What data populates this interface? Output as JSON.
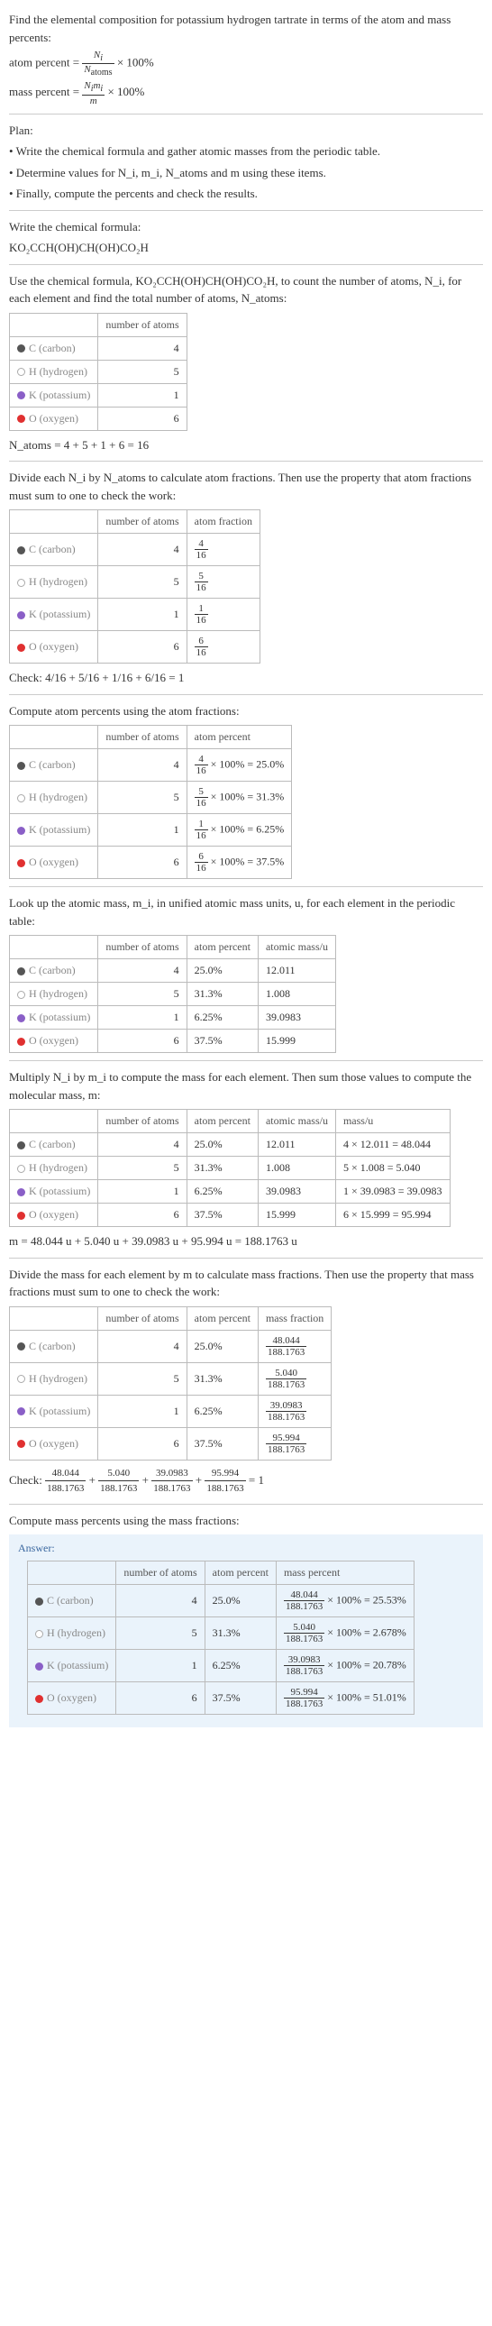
{
  "intro": {
    "line1": "Find the elemental composition for potassium hydrogen tartrate in terms of the atom and mass percents:",
    "atom_percent_label": "atom percent =",
    "atom_percent_num": "N_i",
    "atom_percent_den": "N_atoms",
    "times100": "× 100%",
    "mass_percent_label": "mass percent =",
    "mass_percent_num": "N_i m_i",
    "mass_percent_den": "m"
  },
  "plan": {
    "title": "Plan:",
    "b1": "• Write the chemical formula and gather atomic masses from the periodic table.",
    "b2": "• Determine values for N_i, m_i, N_atoms and m using these items.",
    "b3": "• Finally, compute the percents and check the results."
  },
  "formula": {
    "title": "Write the chemical formula:",
    "text": "KO₂CCH(OH)CH(OH)CO₂H"
  },
  "count": {
    "intro": "Use the chemical formula, KO₂CCH(OH)CH(OH)CO₂H, to count the number of atoms, N_i, for each element and find the total number of atoms, N_atoms:",
    "headers": {
      "col1": "",
      "col2": "number of atoms"
    },
    "rows": [
      {
        "element": "C (carbon)",
        "n": "4",
        "class": "c-carbon"
      },
      {
        "element": "H (hydrogen)",
        "n": "5",
        "class": "c-hydrogen"
      },
      {
        "element": "K (potassium)",
        "n": "1",
        "class": "c-potassium"
      },
      {
        "element": "O (oxygen)",
        "n": "6",
        "class": "c-oxygen"
      }
    ],
    "sum": "N_atoms = 4 + 5 + 1 + 6 = 16"
  },
  "atom_fractions": {
    "intro": "Divide each N_i by N_atoms to calculate atom fractions. Then use the property that atom fractions must sum to one to check the work:",
    "headers": {
      "col1": "",
      "col2": "number of atoms",
      "col3": "atom fraction"
    },
    "rows": [
      {
        "element": "C (carbon)",
        "n": "4",
        "fnum": "4",
        "fden": "16",
        "class": "c-carbon"
      },
      {
        "element": "H (hydrogen)",
        "n": "5",
        "fnum": "5",
        "fden": "16",
        "class": "c-hydrogen"
      },
      {
        "element": "K (potassium)",
        "n": "1",
        "fnum": "1",
        "fden": "16",
        "class": "c-potassium"
      },
      {
        "element": "O (oxygen)",
        "n": "6",
        "fnum": "6",
        "fden": "16",
        "class": "c-oxygen"
      }
    ],
    "check_label": "Check:",
    "check": "4/16 + 5/16 + 1/16 + 6/16 = 1"
  },
  "atom_percents": {
    "intro": "Compute atom percents using the atom fractions:",
    "headers": {
      "col1": "",
      "col2": "number of atoms",
      "col3": "atom percent"
    },
    "rows": [
      {
        "element": "C (carbon)",
        "n": "4",
        "fnum": "4",
        "fden": "16",
        "pct": "× 100% = 25.0%",
        "class": "c-carbon"
      },
      {
        "element": "H (hydrogen)",
        "n": "5",
        "fnum": "5",
        "fden": "16",
        "pct": "× 100% = 31.3%",
        "class": "c-hydrogen"
      },
      {
        "element": "K (potassium)",
        "n": "1",
        "fnum": "1",
        "fden": "16",
        "pct": "× 100% = 6.25%",
        "class": "c-potassium"
      },
      {
        "element": "O (oxygen)",
        "n": "6",
        "fnum": "6",
        "fden": "16",
        "pct": "× 100% = 37.5%",
        "class": "c-oxygen"
      }
    ]
  },
  "atomic_mass": {
    "intro": "Look up the atomic mass, m_i, in unified atomic mass units, u, for each element in the periodic table:",
    "headers": {
      "col1": "",
      "col2": "number of atoms",
      "col3": "atom percent",
      "col4": "atomic mass/u"
    },
    "rows": [
      {
        "element": "C (carbon)",
        "n": "4",
        "pct": "25.0%",
        "mass": "12.011",
        "class": "c-carbon"
      },
      {
        "element": "H (hydrogen)",
        "n": "5",
        "pct": "31.3%",
        "mass": "1.008",
        "class": "c-hydrogen"
      },
      {
        "element": "K (potassium)",
        "n": "1",
        "pct": "6.25%",
        "mass": "39.0983",
        "class": "c-potassium"
      },
      {
        "element": "O (oxygen)",
        "n": "6",
        "pct": "37.5%",
        "mass": "15.999",
        "class": "c-oxygen"
      }
    ]
  },
  "molecular_mass": {
    "intro": "Multiply N_i by m_i to compute the mass for each element. Then sum those values to compute the molecular mass, m:",
    "headers": {
      "col1": "",
      "col2": "number of atoms",
      "col3": "atom percent",
      "col4": "atomic mass/u",
      "col5": "mass/u"
    },
    "rows": [
      {
        "element": "C (carbon)",
        "n": "4",
        "pct": "25.0%",
        "mass": "12.011",
        "calc": "4 × 12.011 = 48.044",
        "class": "c-carbon"
      },
      {
        "element": "H (hydrogen)",
        "n": "5",
        "pct": "31.3%",
        "mass": "1.008",
        "calc": "5 × 1.008 = 5.040",
        "class": "c-hydrogen"
      },
      {
        "element": "K (potassium)",
        "n": "1",
        "pct": "6.25%",
        "mass": "39.0983",
        "calc": "1 × 39.0983 = 39.0983",
        "class": "c-potassium"
      },
      {
        "element": "O (oxygen)",
        "n": "6",
        "pct": "37.5%",
        "mass": "15.999",
        "calc": "6 × 15.999 = 95.994",
        "class": "c-oxygen"
      }
    ],
    "sum": "m = 48.044 u + 5.040 u + 39.0983 u + 95.994 u = 188.1763 u"
  },
  "mass_fractions": {
    "intro": "Divide the mass for each element by m to calculate mass fractions. Then use the property that mass fractions must sum to one to check the work:",
    "headers": {
      "col1": "",
      "col2": "number of atoms",
      "col3": "atom percent",
      "col4": "mass fraction"
    },
    "rows": [
      {
        "element": "C (carbon)",
        "n": "4",
        "pct": "25.0%",
        "fnum": "48.044",
        "fden": "188.1763",
        "class": "c-carbon"
      },
      {
        "element": "H (hydrogen)",
        "n": "5",
        "pct": "31.3%",
        "fnum": "5.040",
        "fden": "188.1763",
        "class": "c-hydrogen"
      },
      {
        "element": "K (potassium)",
        "n": "1",
        "pct": "6.25%",
        "fnum": "39.0983",
        "fden": "188.1763",
        "class": "c-potassium"
      },
      {
        "element": "O (oxygen)",
        "n": "6",
        "pct": "37.5%",
        "fnum": "95.994",
        "fden": "188.1763",
        "class": "c-oxygen"
      }
    ],
    "check_label": "Check:",
    "check_terms": [
      {
        "num": "48.044",
        "den": "188.1763"
      },
      {
        "num": "5.040",
        "den": "188.1763"
      },
      {
        "num": "39.0983",
        "den": "188.1763"
      },
      {
        "num": "95.994",
        "den": "188.1763"
      }
    ],
    "check_result": "= 1"
  },
  "mass_percents": {
    "intro": "Compute mass percents using the mass fractions:",
    "answer_label": "Answer:",
    "headers": {
      "col1": "",
      "col2": "number of atoms",
      "col3": "atom percent",
      "col4": "mass percent"
    },
    "rows": [
      {
        "element": "C (carbon)",
        "n": "4",
        "pct": "25.0%",
        "fnum": "48.044",
        "fden": "188.1763",
        "result": "100% = 25.53%",
        "class": "c-carbon"
      },
      {
        "element": "H (hydrogen)",
        "n": "5",
        "pct": "31.3%",
        "fnum": "5.040",
        "fden": "188.1763",
        "result": "100% = 2.678%",
        "class": "c-hydrogen"
      },
      {
        "element": "K (potassium)",
        "n": "1",
        "pct": "6.25%",
        "fnum": "39.0983",
        "fden": "188.1763",
        "result": "100% = 20.78%",
        "class": "c-potassium"
      },
      {
        "element": "O (oxygen)",
        "n": "6",
        "pct": "37.5%",
        "fnum": "95.994",
        "fden": "188.1763",
        "result": "100% = 51.01%",
        "class": "c-oxygen"
      }
    ]
  },
  "chart_data": {
    "type": "table",
    "title": "Elemental composition of potassium hydrogen tartrate (KO2CCH(OH)CH(OH)CO2H)",
    "N_atoms": 16,
    "molecular_mass_u": 188.1763,
    "elements": [
      {
        "symbol": "C",
        "name": "carbon",
        "N_i": 4,
        "atom_fraction": 0.25,
        "atom_percent": 25.0,
        "atomic_mass_u": 12.011,
        "mass_u": 48.044,
        "mass_fraction": 0.2553,
        "mass_percent": 25.53
      },
      {
        "symbol": "H",
        "name": "hydrogen",
        "N_i": 5,
        "atom_fraction": 0.3125,
        "atom_percent": 31.3,
        "atomic_mass_u": 1.008,
        "mass_u": 5.04,
        "mass_fraction": 0.02678,
        "mass_percent": 2.678
      },
      {
        "symbol": "K",
        "name": "potassium",
        "N_i": 1,
        "atom_fraction": 0.0625,
        "atom_percent": 6.25,
        "atomic_mass_u": 39.0983,
        "mass_u": 39.0983,
        "mass_fraction": 0.2078,
        "mass_percent": 20.78
      },
      {
        "symbol": "O",
        "name": "oxygen",
        "N_i": 6,
        "atom_fraction": 0.375,
        "atom_percent": 37.5,
        "atomic_mass_u": 15.999,
        "mass_u": 95.994,
        "mass_fraction": 0.5101,
        "mass_percent": 51.01
      }
    ]
  }
}
